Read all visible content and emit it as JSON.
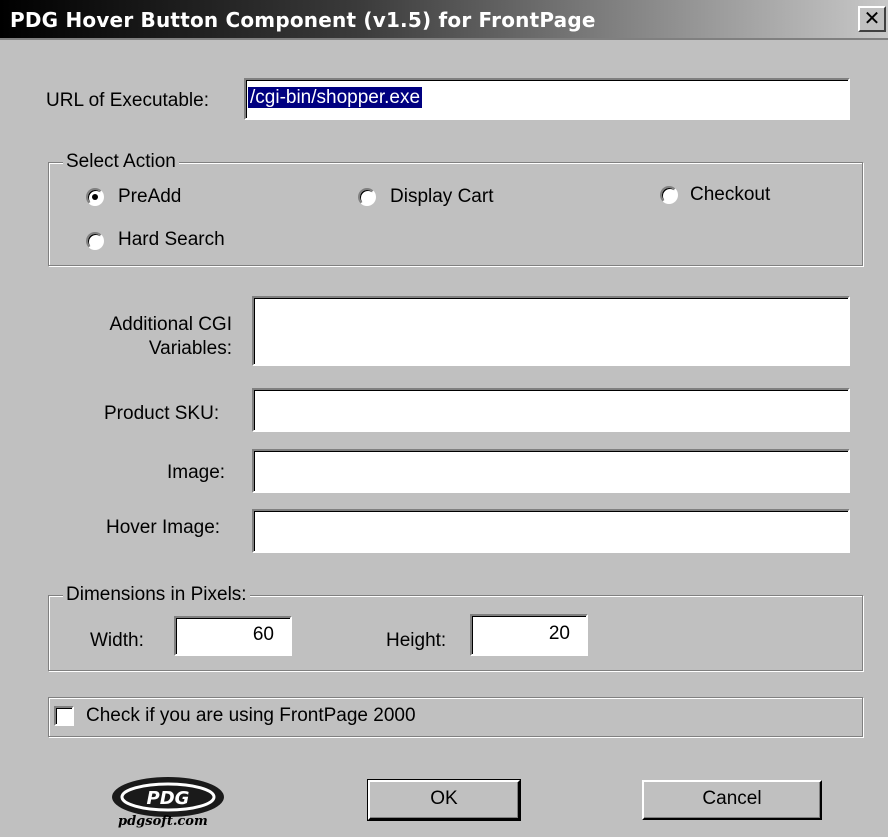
{
  "window": {
    "title": "PDG Hover Button Component (v1.5) for FrontPage",
    "close_icon": "close-icon",
    "close_glyph": "✕"
  },
  "url": {
    "label": "URL of Executable:",
    "value": "/cgi-bin/shopper.exe"
  },
  "action": {
    "legend": "Select Action",
    "options": [
      {
        "label": "PreAdd",
        "checked": true
      },
      {
        "label": "Display Cart",
        "checked": false
      },
      {
        "label": "Checkout",
        "checked": false
      },
      {
        "label": "Hard Search",
        "checked": false
      }
    ]
  },
  "cgi_vars": {
    "label_line1": "Additional CGI",
    "label_line2": "Variables:",
    "value": ""
  },
  "sku": {
    "label": "Product SKU:",
    "value": ""
  },
  "image": {
    "label": "Image:",
    "value": ""
  },
  "hover_image": {
    "label": "Hover Image:",
    "value": ""
  },
  "dimensions": {
    "legend": "Dimensions in Pixels:",
    "width_label": "Width:",
    "width_value": "60",
    "height_label": "Height:",
    "height_value": "20"
  },
  "frontpage2000": {
    "label": "Check if you are using FrontPage 2000",
    "checked": false
  },
  "buttons": {
    "ok": "OK",
    "cancel": "Cancel"
  },
  "logo": {
    "mark": "PDG",
    "site": "pdgsoft.com"
  },
  "colors": {
    "dialog_bg": "#c0c0c0",
    "selection": "#000080"
  }
}
